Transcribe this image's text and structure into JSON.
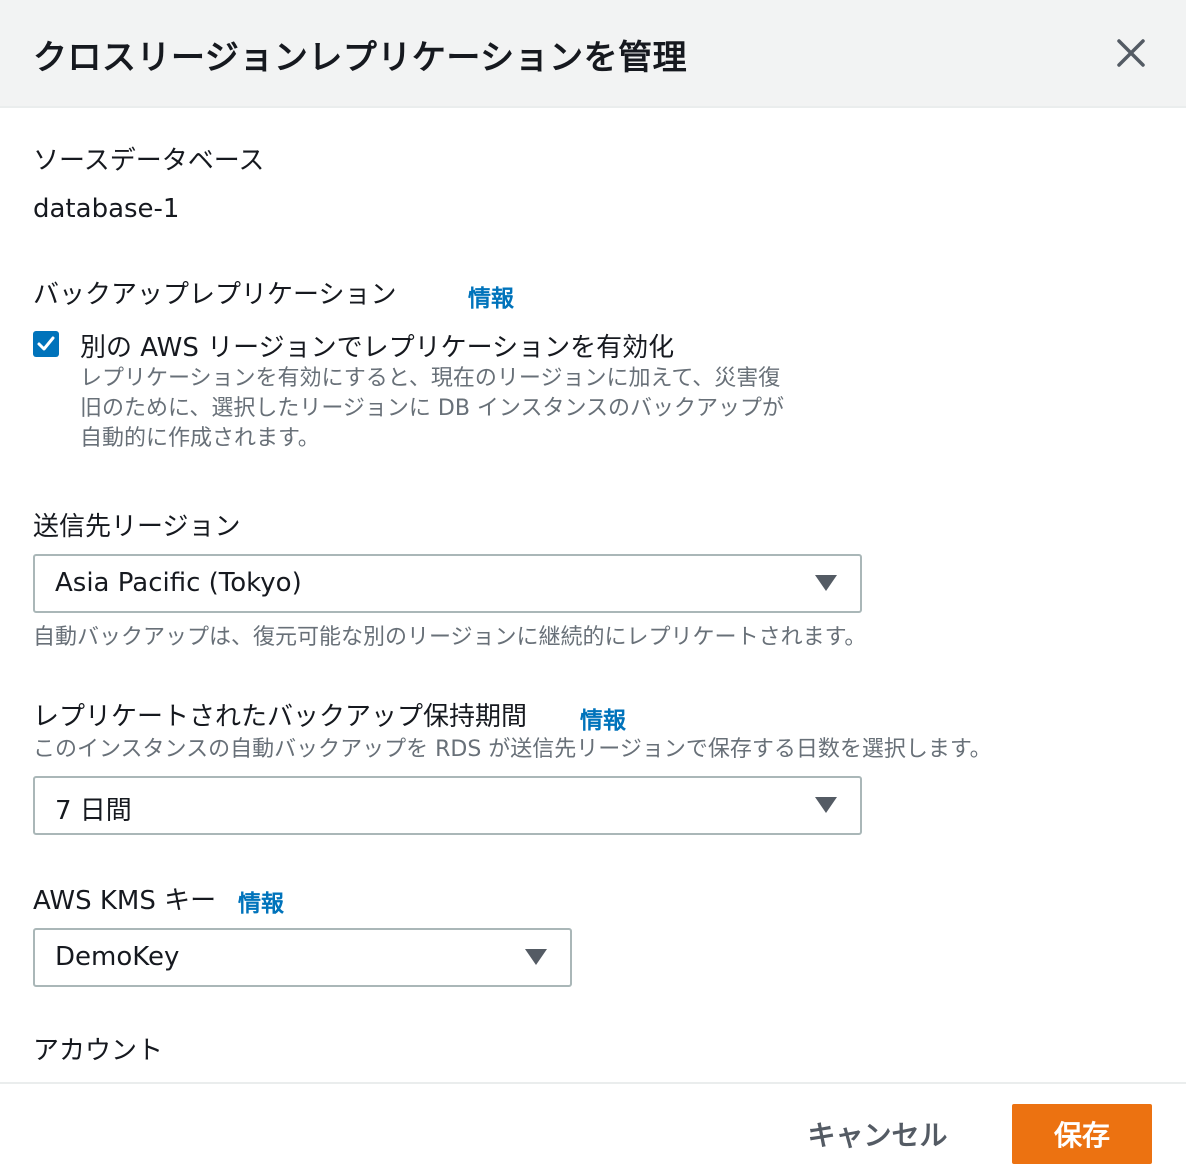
{
  "dialog": {
    "title": "クロスリージョンレプリケーションを管理"
  },
  "source_database": {
    "label": "ソースデータベース",
    "value": "database-1"
  },
  "backup_replication": {
    "label": "バックアップレプリケーション",
    "info": "情報",
    "checkbox_label": "別の AWS リージョンでレプリケーションを有効化",
    "checked": true,
    "description_lines": [
      "レプリケーションを有効にすると、現在のリージョンに加えて、災害復",
      "旧のために、選択したリージョンに DB インスタンスのバックアップが",
      "自動的に作成されます。"
    ]
  },
  "destination_region": {
    "label": "送信先リージョン",
    "selected": "Asia Pacific (Tokyo)",
    "hint": "自動バックアップは、復元可能な別のリージョンに継続的にレプリケートされます。"
  },
  "retention": {
    "label": "レプリケートされたバックアップ保持期間",
    "info": "情報",
    "description": "このインスタンスの自動バックアップを RDS が送信先リージョンで保存する日数を選択します。",
    "selected": "7 日間"
  },
  "kms": {
    "label": "AWS KMS キー",
    "info": "情報",
    "selected": "DemoKey"
  },
  "account": {
    "label": "アカウント"
  },
  "footer": {
    "cancel_label": "キャンセル",
    "save_label": "保存"
  },
  "colors": {
    "accent": "#0073bb",
    "primary_button": "#ec7211"
  }
}
